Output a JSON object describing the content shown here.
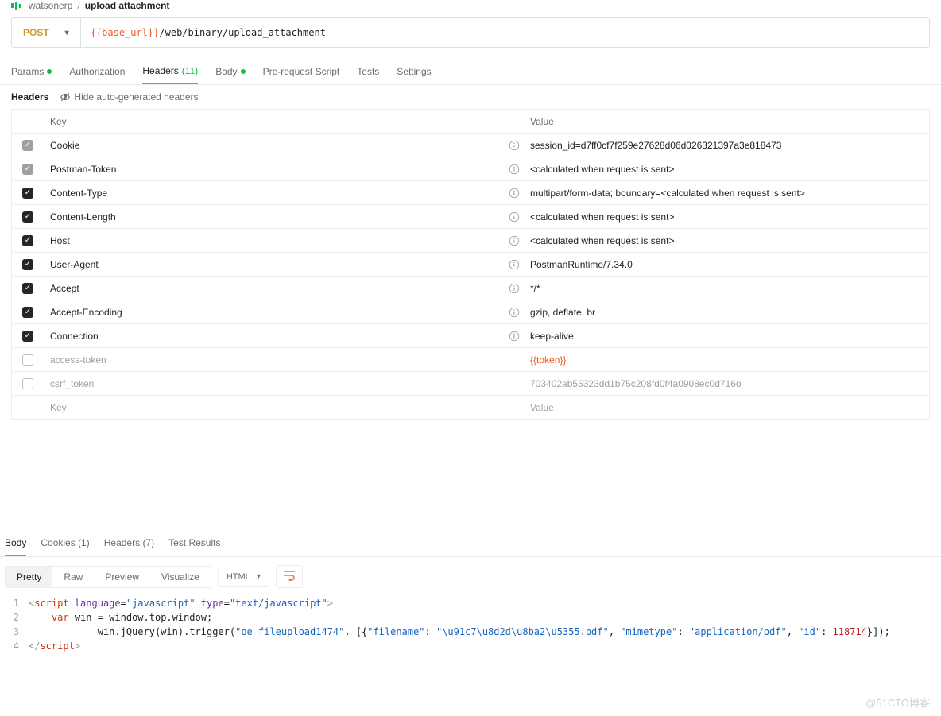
{
  "breadcrumb": {
    "workspace": "watsonerp",
    "request": "upload attachment"
  },
  "request": {
    "method": "POST",
    "url_var": "{{base_url}}",
    "url_path": "/web/binary/upload_attachment"
  },
  "tabs": {
    "params": "Params",
    "authorization": "Authorization",
    "headers": "Headers",
    "headers_count": "(11)",
    "body": "Body",
    "prerequest": "Pre-request Script",
    "tests": "Tests",
    "settings": "Settings"
  },
  "subheader": {
    "title": "Headers",
    "hide_label": "Hide auto-generated headers"
  },
  "headers_table": {
    "key_label": "Key",
    "value_label": "Value",
    "key_placeholder": "Key",
    "value_placeholder": "Value",
    "rows": [
      {
        "checked": "locked",
        "key": "Cookie",
        "value": "session_id=d7ff0cf7f259e27628d06d026321397a3e818473",
        "info": true
      },
      {
        "checked": "locked",
        "key": "Postman-Token",
        "value": "<calculated when request is sent>",
        "info": true
      },
      {
        "checked": "on",
        "key": "Content-Type",
        "value": "multipart/form-data; boundary=<calculated when request is sent>",
        "info": true
      },
      {
        "checked": "on",
        "key": "Content-Length",
        "value": "<calculated when request is sent>",
        "info": true
      },
      {
        "checked": "on",
        "key": "Host",
        "value": "<calculated when request is sent>",
        "info": true
      },
      {
        "checked": "on",
        "key": "User-Agent",
        "value": "PostmanRuntime/7.34.0",
        "info": true
      },
      {
        "checked": "on",
        "key": "Accept",
        "value": "*/*",
        "info": true
      },
      {
        "checked": "on",
        "key": "Accept-Encoding",
        "value": "gzip, deflate, br",
        "info": true
      },
      {
        "checked": "on",
        "key": "Connection",
        "value": "keep-alive",
        "info": true
      },
      {
        "checked": "off",
        "key": "access-token",
        "value": "{{token}}",
        "info": false,
        "is_var": true,
        "disabled": true
      },
      {
        "checked": "off",
        "key": "csrf_token",
        "value": "703402ab55323dd1b75c208fd0f4a0908ec0d716o",
        "info": false,
        "disabled": true
      }
    ]
  },
  "response": {
    "tabs": {
      "body": "Body",
      "cookies": "Cookies",
      "cookies_count": "(1)",
      "headers": "Headers",
      "headers_count": "(7)",
      "test_results": "Test Results"
    },
    "view_modes": {
      "pretty": "Pretty",
      "raw": "Raw",
      "preview": "Preview",
      "visualize": "Visualize"
    },
    "lang": "HTML",
    "code_lines": [
      {
        "n": "1",
        "html": "<span style='color:#999'>&lt;</span><span style='color:#c83811'>script</span> <span style='color:#6b2fa0'>language</span>=<span style='color:#1565c0'>\"javascript\"</span> <span style='color:#6b2fa0'>type</span>=<span style='color:#1565c0'>\"text/javascript\"</span><span style='color:#999'>&gt;</span>"
      },
      {
        "n": "2",
        "html": "    <span style='color:#c83811'>var</span> win = window.top.window;"
      },
      {
        "n": "3",
        "html": "            win.jQuery(win).trigger(<span style='color:#1565c0'>\"oe_fileupload1474\"</span>, [{<span style='color:#1565c0'>\"filename\"</span>: <span style='color:#1565c0'>\"\\u91c7\\u8d2d\\u8ba2\\u5355.pdf\"</span>, <span style='color:#1565c0'>\"mimetype\"</span>: <span style='color:#1565c0'>\"application/pdf\"</span>, <span style='color:#1565c0'>\"id\"</span>: <span style='color:#b71c1c'>118714</span>}]);"
      },
      {
        "n": "4",
        "html": "<span style='color:#999'>&lt;/</span><span style='color:#c83811'>script</span><span style='color:#999'>&gt;</span>"
      }
    ]
  },
  "watermark": "@51CTO博客"
}
